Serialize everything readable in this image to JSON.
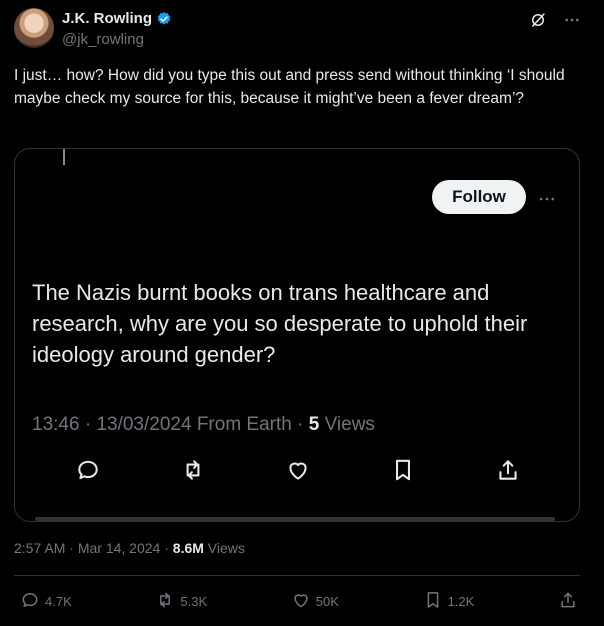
{
  "author": {
    "name": "J.K. Rowling",
    "handle": "@jk_rowling"
  },
  "tweet": {
    "text": "I just… how? How did you type this out and press send without thinking ‘I should maybe check my source for this, because it might’ve been a fever dream’?",
    "time": "2:57 AM",
    "date": "Mar 14, 2024",
    "views_count": "8.6M",
    "views_label": "Views"
  },
  "embed": {
    "follow_label": "Follow",
    "text": "The Nazis burnt books on trans healthcare and research, why are you so desperate to uphold their ideology around gender?",
    "time": "13:46",
    "date": "13/03/2024",
    "source": "From Earth",
    "views_count": "5",
    "views_label": "Views"
  },
  "stats": {
    "replies": "4.7K",
    "reposts": "5.3K",
    "likes": "50K",
    "bookmarks": "1.2K"
  },
  "colors": {
    "background": "#000000",
    "text": "#e7e9ea",
    "muted": "#71767b",
    "border": "#2f3336",
    "verified": "#1d9bf0"
  },
  "icons": [
    "verified-badge-icon",
    "grok-icon",
    "more-icon",
    "reply-icon",
    "repost-icon",
    "like-icon",
    "bookmark-icon",
    "share-icon"
  ]
}
